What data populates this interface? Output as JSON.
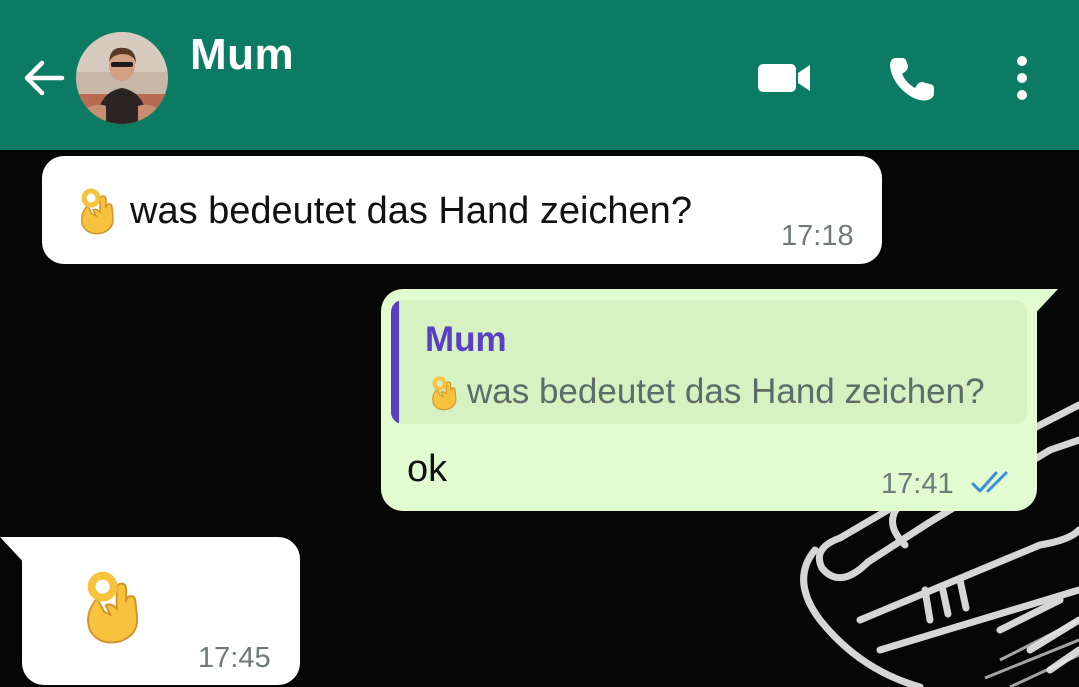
{
  "header": {
    "contact_name": "Mum",
    "bg_color": "#0b7b64",
    "back_icon": "arrow-left-icon",
    "actions": [
      "video-call-icon",
      "phone-icon",
      "more-vert-icon"
    ]
  },
  "messages": [
    {
      "direction": "incoming",
      "emoji": "ok-hand-icon",
      "text": "was bedeutet das Hand zeichen?",
      "time": "17:18"
    },
    {
      "direction": "outgoing",
      "quote": {
        "author": "Mum",
        "emoji": "ok-hand-icon",
        "text": "was bedeutet das Hand zeichen?"
      },
      "text": "ok",
      "time": "17:41",
      "status": "read",
      "status_color": "#3b8fd8"
    },
    {
      "direction": "incoming",
      "emoji": "ok-hand-icon",
      "time": "17:45"
    }
  ],
  "colors": {
    "outgoing_bubble": "#e3fbd0",
    "incoming_bubble": "#ffffff",
    "quote_accent": "#5a3ec8",
    "chat_background": "#060606"
  }
}
